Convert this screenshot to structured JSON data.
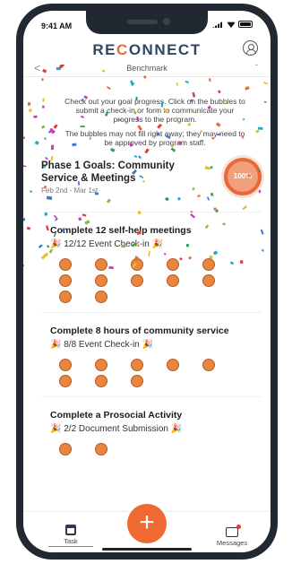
{
  "status_bar": {
    "time": "9:41 AM"
  },
  "header": {
    "logo_pre": "RE",
    "logo_o": "C",
    "logo_post": "ONNECT"
  },
  "subbar": {
    "back": "<",
    "title": "Benchmark"
  },
  "info": {
    "line1": "Check out your goal progress. Click on the bubbles to submit a check-in or form to communicate your progress to the program.",
    "line2": "The bubbles may not fill right away; they may need to be approved by program staff."
  },
  "phase": {
    "title": "Phase 1 Goals: Community Service & Meetings",
    "dates": "Feb 2nd - Mar 1st",
    "progress_label": "100%",
    "progress_value": 100
  },
  "goals": [
    {
      "title": "Complete 12 self-help meetings",
      "subtitle": "12/12 Event Check-in",
      "count": 12
    },
    {
      "title": "Complete 8 hours of community service",
      "subtitle": "8/8 Event Check-in",
      "count": 8
    },
    {
      "title": "Complete a Prosocial Activity",
      "subtitle": "2/2 Document Submission",
      "count": 2
    }
  ],
  "nav": {
    "task": "Task",
    "messages": "Messages",
    "fab": "+"
  },
  "colors": {
    "accent": "#ef6a32",
    "navy": "#2e4863",
    "bubble": "#e8863f"
  }
}
